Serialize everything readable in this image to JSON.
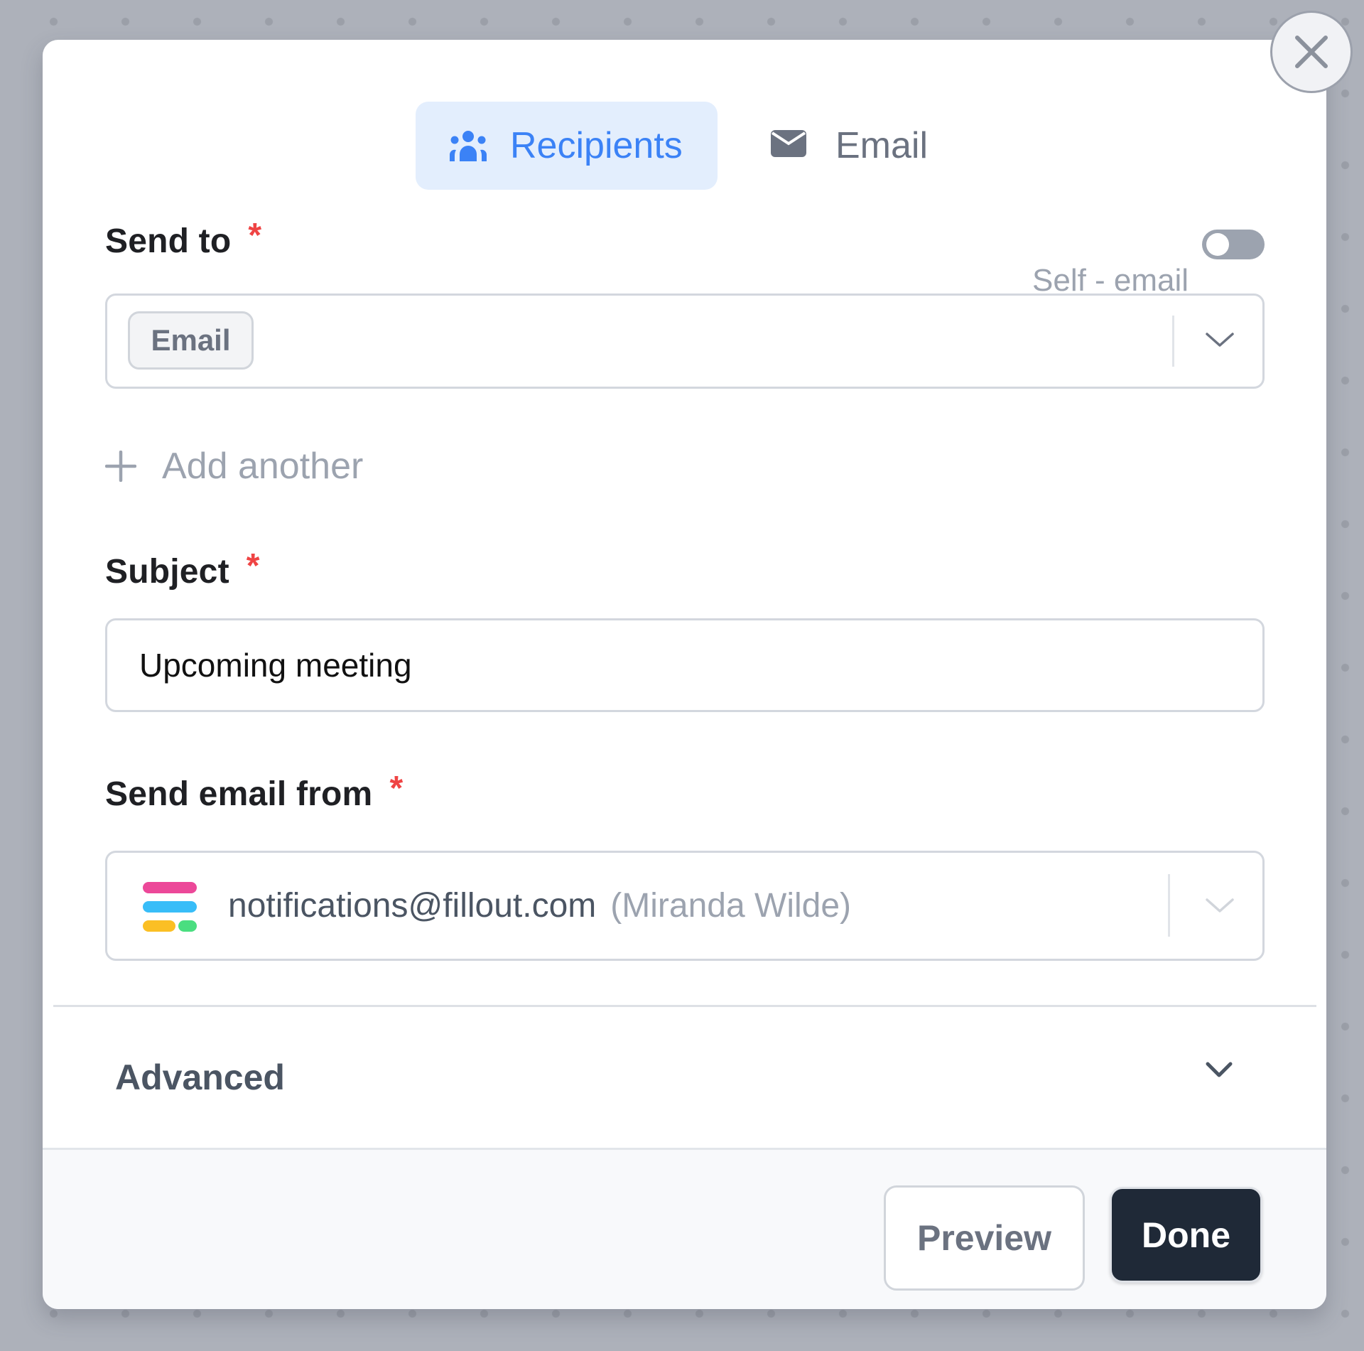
{
  "tabs": [
    {
      "label": "Recipients",
      "icon": "users-icon",
      "active": true
    },
    {
      "label": "Email",
      "icon": "envelope-icon",
      "active": false
    }
  ],
  "colors": {
    "accent": "#3b82f6",
    "required": "#ef4444",
    "done_button": "#1f2937",
    "muted_text": "#9ca3af"
  },
  "send_to": {
    "label": "Send to",
    "required_mark": "*",
    "self_email_label": "Self - email",
    "self_email_enabled": false,
    "selected_chip": "Email"
  },
  "add_another": {
    "label": "Add another"
  },
  "subject": {
    "label": "Subject",
    "required_mark": "*",
    "value": "Upcoming meeting"
  },
  "send_from": {
    "label": "Send email from",
    "required_mark": "*",
    "email": "notifications@fillout.com",
    "name": "(Miranda Wilde)",
    "logo_colors": [
      "#ec4899",
      "#38bdf8",
      "#fbbf24",
      "#4ade80"
    ]
  },
  "advanced": {
    "label": "Advanced"
  },
  "footer": {
    "preview_label": "Preview",
    "done_label": "Done"
  }
}
